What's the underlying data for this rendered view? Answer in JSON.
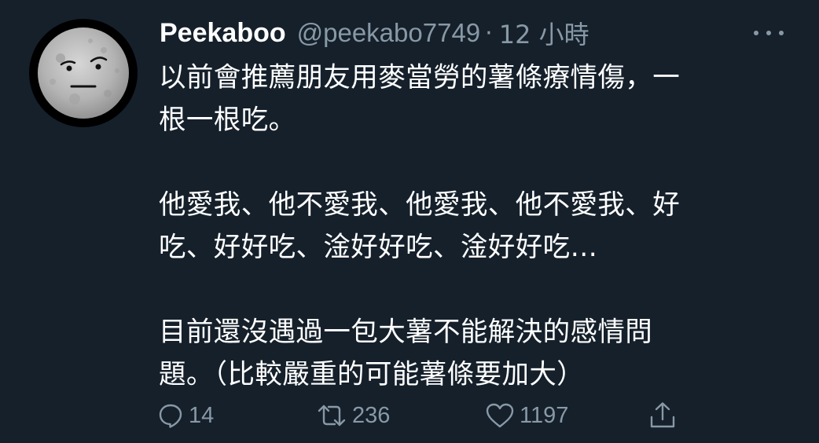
{
  "tweet": {
    "author": {
      "display_name": "Peekaboo",
      "handle": "@peekabo7749",
      "avatar_icon": "moon-face-avatar"
    },
    "separator": "·",
    "time": "12 小時",
    "more_icon": "more-horizontal-icon",
    "paragraphs": [
      {
        "lines": [
          "以前會推薦朋友用麥當勞的薯條療情傷，一",
          "根一根吃。"
        ]
      },
      {
        "lines": [
          "他愛我、他不愛我、他愛我、他不愛我、好",
          "吃、好好吃、淦好好吃、淦好好吃…"
        ]
      },
      {
        "lines": [
          "目前還沒遇過一包大薯不能解決的感情問",
          "題。（比較嚴重的可能薯條要加大）"
        ]
      }
    ],
    "actions": {
      "reply": {
        "icon": "reply-icon",
        "count": "14"
      },
      "retweet": {
        "icon": "retweet-icon",
        "count": "236"
      },
      "like": {
        "icon": "heart-icon",
        "count": "1197"
      },
      "share": {
        "icon": "share-icon"
      }
    }
  },
  "colors": {
    "background": "#15202b",
    "text_primary": "#ffffff",
    "text_secondary": "#8899a6"
  }
}
